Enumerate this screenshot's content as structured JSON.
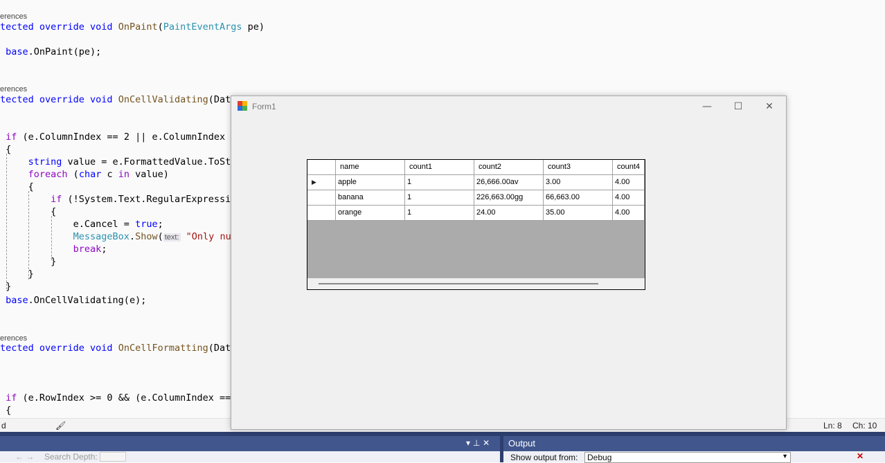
{
  "editor": {
    "lines": [
      {
        "kind": "ref",
        "text": "erences"
      },
      {
        "kind": "code",
        "segs": [
          [
            "kw",
            "tected override void "
          ],
          [
            "fn",
            "OnPaint"
          ],
          [
            "",
            "("
          ],
          [
            "ty",
            "PaintEventArgs"
          ],
          [
            "",
            " pe)"
          ]
        ]
      },
      {
        "kind": "code",
        "segs": [
          [
            "",
            ""
          ]
        ]
      },
      {
        "kind": "code",
        "segs": [
          [
            "kw",
            " base"
          ],
          [
            "",
            ".OnPaint(pe);"
          ]
        ]
      },
      {
        "kind": "ref",
        "text": "erences"
      },
      {
        "kind": "code",
        "segs": [
          [
            "kw",
            "tected override void "
          ],
          [
            "fn",
            "OnCellValidating"
          ],
          [
            "",
            "(Data"
          ]
        ]
      },
      {
        "kind": "code",
        "segs": [
          [
            "kc",
            " if"
          ],
          [
            "",
            " (e.ColumnIndex == 2 || e.ColumnIndex ="
          ]
        ]
      },
      {
        "kind": "code",
        "segs": [
          [
            "",
            " {"
          ]
        ]
      },
      {
        "kind": "code",
        "segs": [
          [
            "kw",
            "     string"
          ],
          [
            "",
            " value = e.FormattedValue.ToSt"
          ]
        ]
      },
      {
        "kind": "code",
        "segs": [
          [
            "kc",
            "     foreach"
          ],
          [
            "",
            " ("
          ],
          [
            "kw",
            "char"
          ],
          [
            "",
            " c "
          ],
          [
            "kc",
            "in"
          ],
          [
            "",
            " value)"
          ]
        ]
      },
      {
        "kind": "code",
        "segs": [
          [
            "",
            "     {"
          ]
        ]
      },
      {
        "kind": "code",
        "segs": [
          [
            "kc",
            "         if"
          ],
          [
            "",
            " (!System.Text.RegularExpressi"
          ]
        ]
      },
      {
        "kind": "code",
        "segs": [
          [
            "",
            "         {"
          ]
        ]
      },
      {
        "kind": "code",
        "segs": [
          [
            "",
            "             e.Cancel = "
          ],
          [
            "kw",
            "true"
          ],
          [
            "",
            ";"
          ]
        ]
      },
      {
        "kind": "code",
        "segs": [
          [
            "ty",
            "             MessageBox"
          ],
          [
            "",
            "."
          ],
          [
            "fn",
            "Show"
          ],
          [
            "",
            "("
          ],
          [
            "hint",
            "text:"
          ],
          [
            "",
            " "
          ],
          [
            "st",
            "\"Only nu"
          ]
        ]
      },
      {
        "kind": "code",
        "segs": [
          [
            "kc",
            "             break"
          ],
          [
            "",
            ";"
          ]
        ]
      },
      {
        "kind": "code",
        "segs": [
          [
            "",
            "         }"
          ]
        ]
      },
      {
        "kind": "code",
        "segs": [
          [
            "",
            "     }"
          ]
        ]
      },
      {
        "kind": "code",
        "segs": [
          [
            "",
            " }"
          ]
        ]
      },
      {
        "kind": "code",
        "segs": [
          [
            "kw",
            " base"
          ],
          [
            "",
            ".OnCellValidating(e);"
          ]
        ]
      },
      {
        "kind": "ref",
        "text": "erences"
      },
      {
        "kind": "code",
        "segs": [
          [
            "kw",
            "tected override void "
          ],
          [
            "fn",
            "OnCellFormatting"
          ],
          [
            "",
            "(Data"
          ]
        ]
      },
      {
        "kind": "code",
        "segs": [
          [
            "kc",
            " if"
          ],
          [
            "",
            " (e.RowIndex >= 0 && (e.ColumnIndex =="
          ]
        ]
      },
      {
        "kind": "code",
        "segs": [
          [
            "",
            " {"
          ]
        ]
      }
    ],
    "status": {
      "left": "d",
      "brush": "🖌",
      "ln": "Ln: 8",
      "ch": "Ch: 10"
    }
  },
  "bottom": {
    "left_panel": {
      "pin": "▾ ⊥ ✕",
      "search_depth": "Search Depth:"
    },
    "output": {
      "title": "Output",
      "show_from_label": "Show output from:",
      "source": "Debug"
    }
  },
  "form1": {
    "title": "Form1",
    "controls": {
      "minimize": "—",
      "maximize": "☐",
      "close": "✕"
    },
    "grid": {
      "columns": [
        "name",
        "count1",
        "count2",
        "count3",
        "count4"
      ],
      "rows": [
        [
          "apple",
          "1",
          "26,666.00av",
          "3.00",
          "4.00"
        ],
        [
          "banana",
          "1",
          "226,663.00gg",
          "66,663.00",
          "4.00"
        ],
        [
          "orange",
          "1",
          "24.00",
          "35.00",
          "4.00"
        ]
      ],
      "current_row_marker": "▶"
    }
  }
}
